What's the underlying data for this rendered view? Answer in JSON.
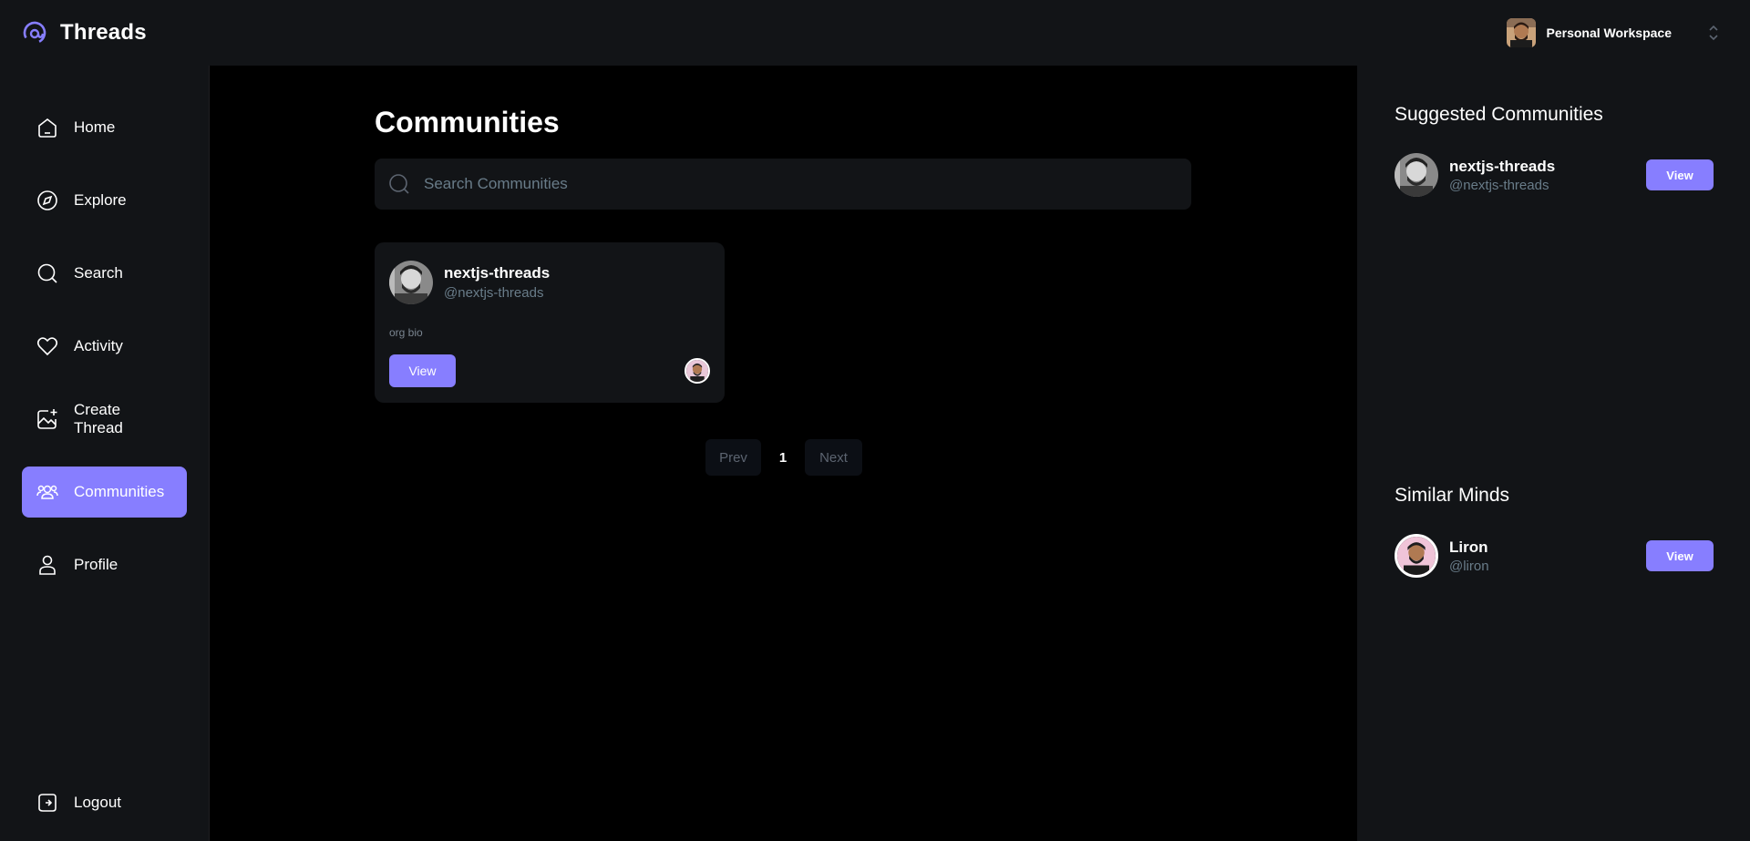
{
  "app": {
    "name": "Threads",
    "accent_color": "#877eff"
  },
  "workspace": {
    "label": "Personal Workspace"
  },
  "sidebar": {
    "items": [
      {
        "label": "Home",
        "icon": "home-icon"
      },
      {
        "label": "Explore",
        "icon": "compass-icon"
      },
      {
        "label": "Search",
        "icon": "search-icon"
      },
      {
        "label": "Activity",
        "icon": "heart-icon"
      },
      {
        "label": "Create Thread",
        "icon": "image-plus-icon"
      },
      {
        "label": "Communities",
        "icon": "users-icon",
        "active": true
      },
      {
        "label": "Profile",
        "icon": "user-icon"
      }
    ],
    "logout_label": "Logout"
  },
  "main": {
    "title": "Communities",
    "search_placeholder": "Search Communities",
    "communities": [
      {
        "name": "nextjs-threads",
        "handle": "@nextjs-threads",
        "bio": "org bio",
        "view_label": "View"
      }
    ],
    "pagination": {
      "prev_label": "Prev",
      "page": "1",
      "next_label": "Next"
    }
  },
  "right": {
    "suggested_title": "Suggested Communities",
    "suggested": [
      {
        "name": "nextjs-threads",
        "handle": "@nextjs-threads",
        "view_label": "View"
      }
    ],
    "similar_title": "Similar Minds",
    "similar": [
      {
        "name": "Liron",
        "handle": "@liron",
        "view_label": "View"
      }
    ]
  }
}
